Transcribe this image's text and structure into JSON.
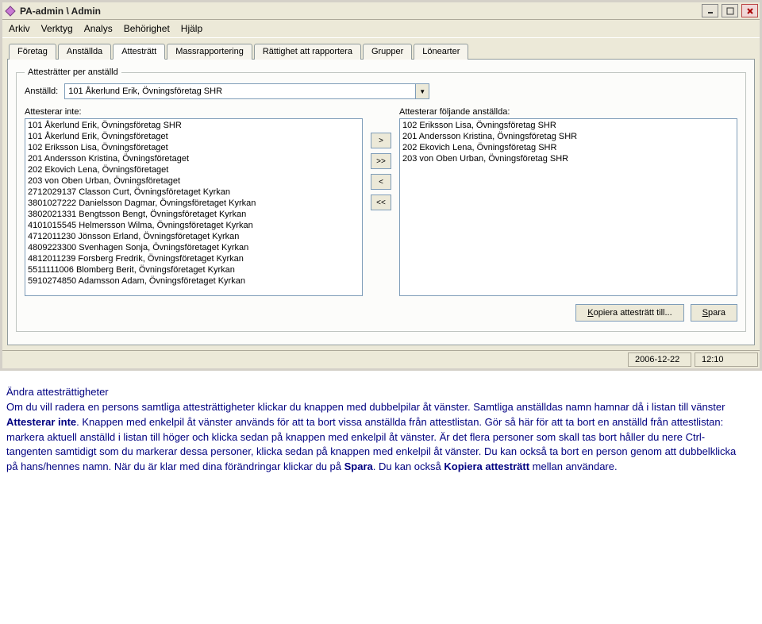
{
  "window": {
    "title": "PA-admin \\ Admin"
  },
  "menu": {
    "items": [
      "Arkiv",
      "Verktyg",
      "Analys",
      "Behörighet",
      "Hjälp"
    ]
  },
  "tabs": {
    "items": [
      "Företag",
      "Anställda",
      "Attesträtt",
      "Massrapportering",
      "Rättighet att rapportera",
      "Grupper",
      "Lönearter"
    ],
    "active_index": 2
  },
  "group": {
    "legend": "Attesträtter per anställd",
    "employee_label": "Anställd:",
    "employee_value": "101 Åkerlund Erik, Övningsföretag SHR",
    "left_label": "Attesterar inte:",
    "right_label": "Attesterar följande anställda:",
    "left_items": [
      "101 Åkerlund Erik, Övningsföretag SHR",
      "101 Åkerlund Erik, Övningsföretaget",
      "102 Eriksson Lisa, Övningsföretaget",
      "201 Andersson Kristina, Övningsföretaget",
      "202 Ekovich Lena, Övningsföretaget",
      "203 von Oben Urban, Övningsföretaget",
      "2712029137 Classon Curt, Övningsföretaget Kyrkan",
      "3801027222 Danielsson Dagmar, Övningsföretaget Kyrkan",
      "3802021331 Bengtsson Bengt, Övningsföretaget Kyrkan",
      "4101015545 Helmersson Wilma, Övningsföretaget Kyrkan",
      "4712011230 Jönsson Erland, Övningsföretaget Kyrkan",
      "4809223300 Svenhagen Sonja, Övningsföretaget Kyrkan",
      "4812011239 Forsberg Fredrik, Övningsföretaget Kyrkan",
      "5511111006 Blomberg Berit, Övningsföretaget Kyrkan",
      "5910274850 Adamsson Adam, Övningsföretaget Kyrkan"
    ],
    "right_items": [
      "102 Eriksson Lisa, Övningsföretag SHR",
      "201 Andersson Kristina, Övningsföretag SHR",
      "202 Ekovich Lena, Övningsföretag SHR",
      "203 von Oben Urban, Övningsföretag SHR"
    ],
    "move": {
      "add": ">",
      "add_all": ">>",
      "remove": "<",
      "remove_all": "<<"
    }
  },
  "buttons": {
    "copy": "Kopiera attesträtt till...",
    "save": "Spara"
  },
  "status": {
    "date": "2006-12-22",
    "time": "12:10"
  },
  "doc": {
    "heading": "Ändra attesträttigheter",
    "p1a": "Om du vill radera en persons samtliga attesträttigheter klickar du knappen med dubbelpilar åt vänster. Samtliga anställdas namn hamnar då i listan till vänster ",
    "p1b_bold": "Attesterar inte",
    "p1c": ". Knappen med enkelpil åt vänster används för att ta bort vissa anställda från attestlistan. Gör så här för att ta bort en anställd från attestlistan: markera aktuell anställd i listan till höger och klicka sedan på knappen med enkelpil åt vänster. Är det flera personer som skall tas bort håller du nere Ctrl-tangenten samtidigt som du markerar dessa personer, klicka sedan på knappen med enkelpil åt vänster. Du kan också ta bort en person genom att dubbelklicka på hans/hennes namn. När du är klar med dina förändringar klickar du på ",
    "p1d_bold": "Spara",
    "p1e": ". Du kan också ",
    "p1f_bold": "Kopiera attesträtt",
    "p1g": " mellan användare."
  }
}
